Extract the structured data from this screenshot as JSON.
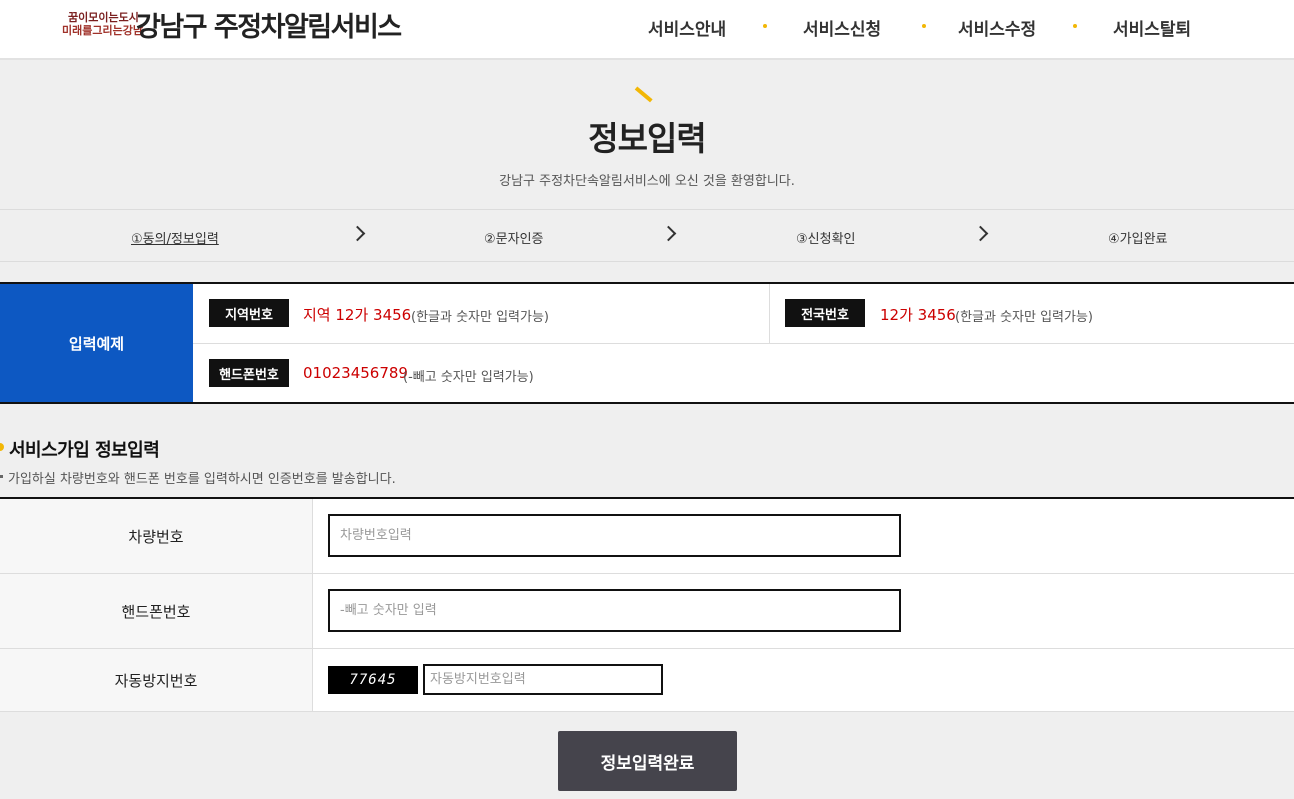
{
  "header": {
    "logo_line1": "꿈이모이는도시",
    "logo_line2": "미래를그리는강남",
    "title": "강남구 주정차알림서비스",
    "nav": [
      "서비스안내",
      "서비스신청",
      "서비스수정",
      "서비스탈퇴"
    ]
  },
  "page": {
    "title": "정보입력",
    "subtitle": "강남구 주정차단속알림서비스에 오신 것을 환영합니다."
  },
  "steps": [
    "①동의/정보입력",
    "②문자인증",
    "③신청확인",
    "④가입완료"
  ],
  "example": {
    "label": "입력예제",
    "local": {
      "badge": "지역번호",
      "value": "지역 12가 3456",
      "note": "(한글과 숫자만 입력가능)"
    },
    "national": {
      "badge": "전국번호",
      "value": "12가 3456",
      "note": "(한글과 숫자만 입력가능)"
    },
    "phone": {
      "badge": "핸드폰번호",
      "value": "01023456789",
      "note": "(-빼고 숫자만 입력가능)"
    }
  },
  "section": {
    "title": "서비스가입 정보입력",
    "desc": "가입하실 차량번호와 핸드폰 번호를 입력하시면 인증번호를 발송합니다."
  },
  "form": {
    "car": {
      "label": "차량번호",
      "placeholder": "차량번호입력",
      "value": ""
    },
    "phone": {
      "label": "핸드폰번호",
      "placeholder": "-빼고 숫자만 입력",
      "value": ""
    },
    "captcha": {
      "label": "자동방지번호",
      "code": "77645",
      "placeholder": "자동방지번호입력",
      "value": ""
    }
  },
  "submit_label": "정보입력완료",
  "colors": {
    "accent": "#f2b705",
    "example_blue": "#0d58c2",
    "value_red": "#cc0000",
    "button": "#45444c"
  }
}
